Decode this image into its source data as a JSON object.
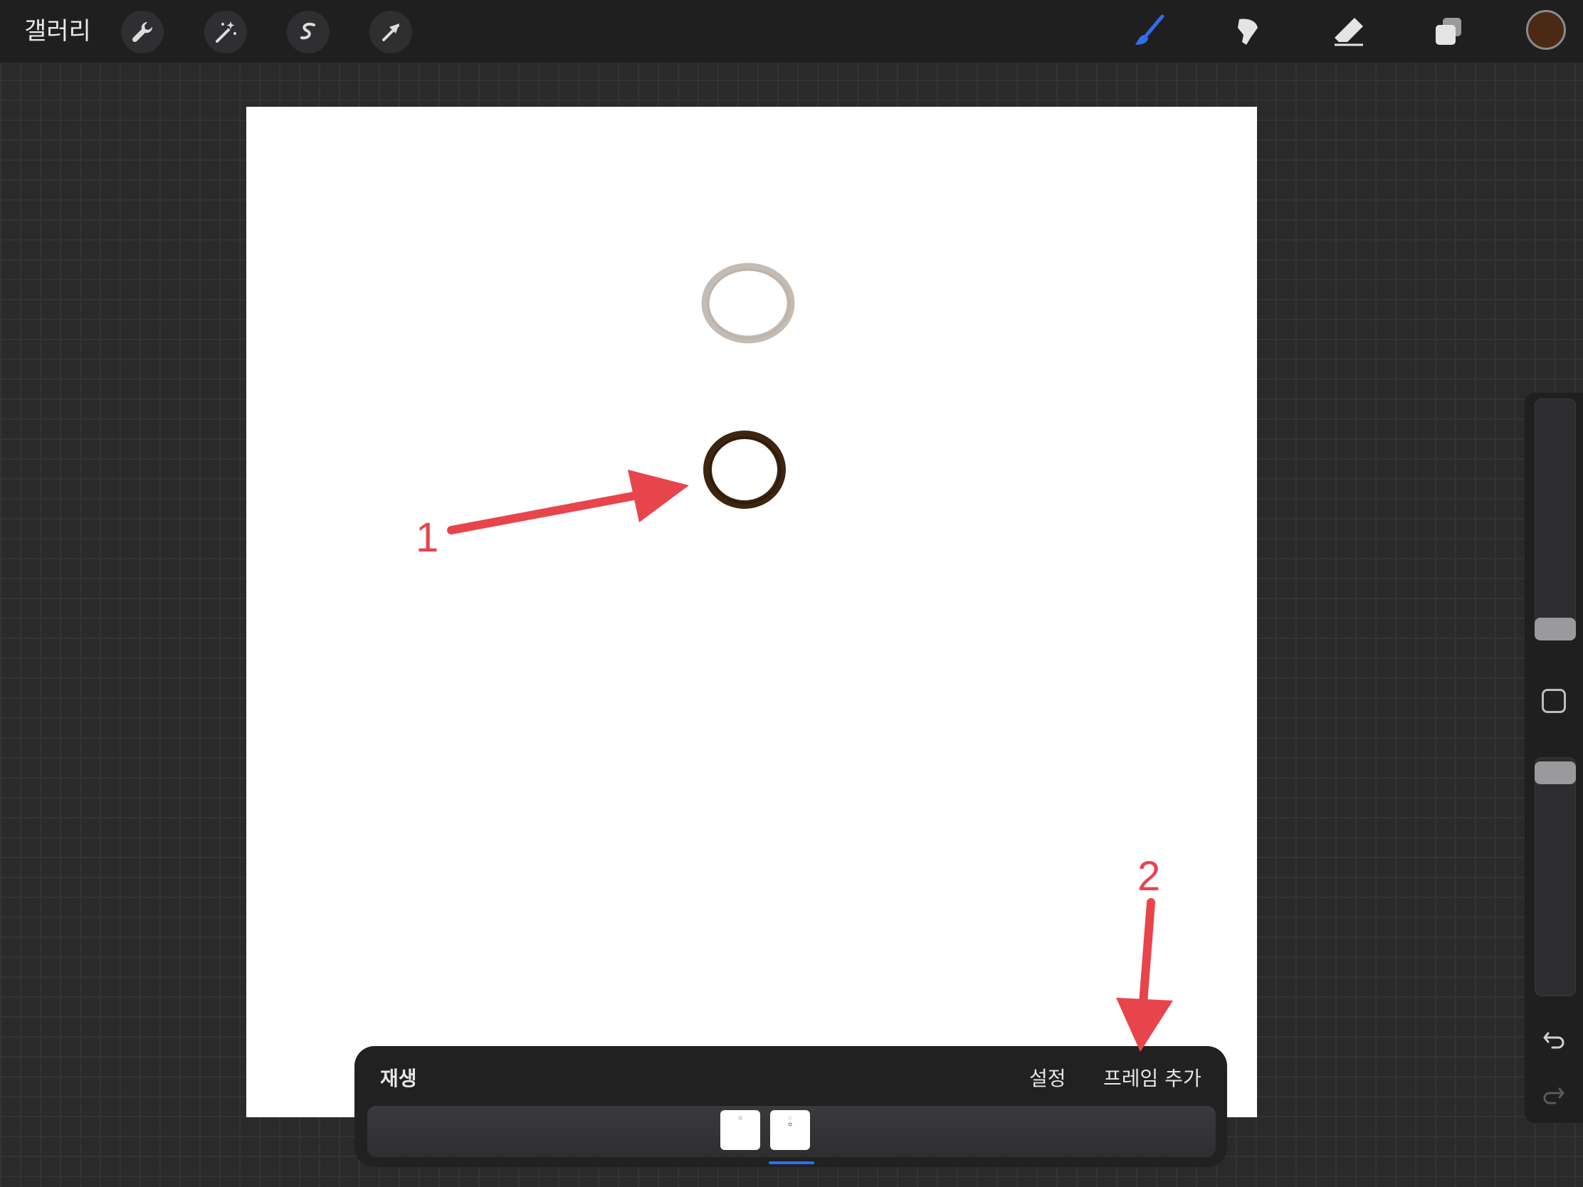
{
  "topbar": {
    "gallery_label": "갤러리",
    "left_tools": [
      "wrench-icon",
      "magic-wand-icon",
      "selection-icon",
      "transform-arrow-icon"
    ],
    "right_tools": [
      "brush-icon",
      "smudge-icon",
      "eraser-icon",
      "layers-icon"
    ],
    "active_tool": "brush",
    "accent_color": "#2f6ef0",
    "current_color": "#4a2a14"
  },
  "canvas": {
    "background": "#ffffff",
    "onion_skin_circle_color": "#c4bcb4",
    "current_circle_color": "#3d2510"
  },
  "sidebar": {
    "icons": [
      "modify-square-icon",
      "undo-icon",
      "redo-icon"
    ]
  },
  "animation_panel": {
    "play_label": "재생",
    "settings_label": "설정",
    "add_frame_label": "프레임 추가",
    "frames": [
      "frame-1",
      "frame-2"
    ],
    "selected_frame": 2
  },
  "annotations": {
    "label_1": "1",
    "label_2": "2",
    "arrow_color": "#e8444c"
  }
}
